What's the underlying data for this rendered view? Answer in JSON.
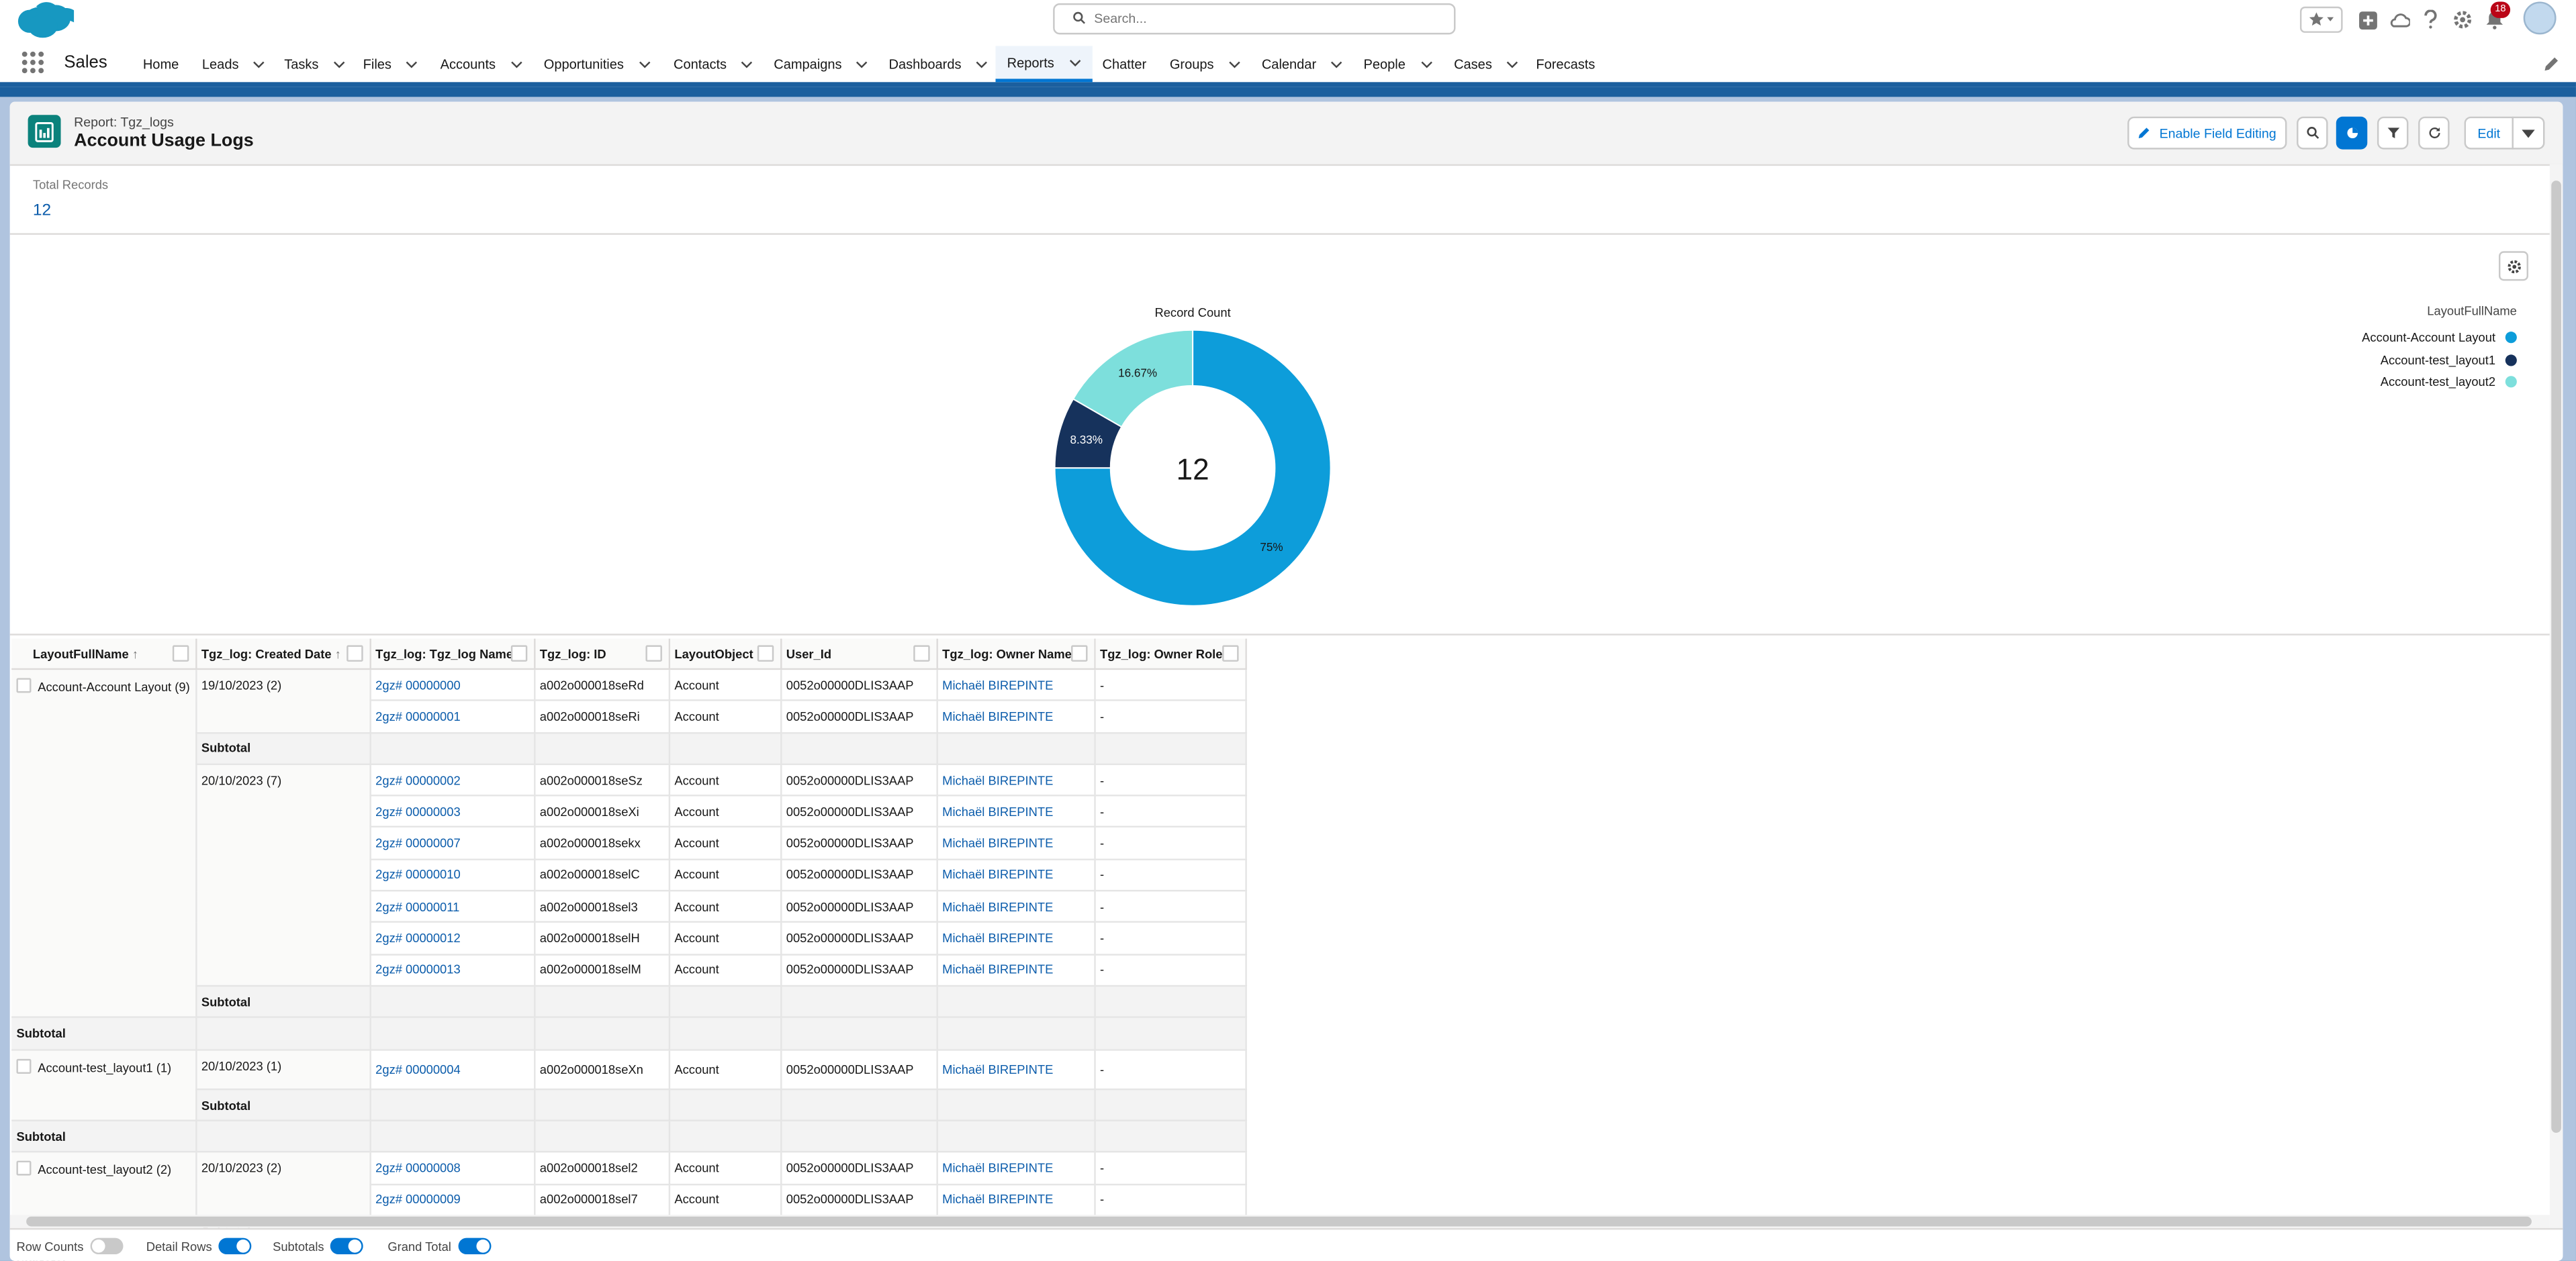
{
  "global": {
    "search_placeholder": "Search...",
    "notification_count": "18"
  },
  "nav": {
    "app_name": "Sales",
    "items": [
      {
        "label": "Home",
        "dropdown": false
      },
      {
        "label": "Leads",
        "dropdown": true
      },
      {
        "label": "Tasks",
        "dropdown": true
      },
      {
        "label": "Files",
        "dropdown": true
      },
      {
        "label": "Accounts",
        "dropdown": true
      },
      {
        "label": "Opportunities",
        "dropdown": true
      },
      {
        "label": "Contacts",
        "dropdown": true
      },
      {
        "label": "Campaigns",
        "dropdown": true
      },
      {
        "label": "Dashboards",
        "dropdown": true
      },
      {
        "label": "Reports",
        "dropdown": true,
        "active": true
      },
      {
        "label": "Chatter",
        "dropdown": false
      },
      {
        "label": "Groups",
        "dropdown": true
      },
      {
        "label": "Calendar",
        "dropdown": true
      },
      {
        "label": "People",
        "dropdown": true
      },
      {
        "label": "Cases",
        "dropdown": true
      },
      {
        "label": "Forecasts",
        "dropdown": false
      }
    ]
  },
  "report": {
    "eyebrow": "Report: Tgz_logs",
    "title": "Account Usage Logs",
    "enable_field_editing": "Enable Field Editing",
    "edit": "Edit",
    "total_records_label": "Total Records",
    "total_records_value": "12"
  },
  "chart": {
    "title": "Record Count",
    "center_value": "12",
    "legend_title": "LayoutFullName",
    "colors": {
      "Account-Account Layout": "#0d9dda",
      "Account-test_layout1": "#16325c",
      "Account-test_layout2": "#7ddfdc"
    }
  },
  "chart_data": {
    "type": "pie",
    "title": "Record Count",
    "categories": [
      "Account-Account Layout",
      "Account-test_layout1",
      "Account-test_layout2"
    ],
    "values": [
      9,
      1,
      2
    ],
    "labels": [
      "75%",
      "8.33%",
      "16.67%"
    ],
    "legend": "top-right"
  },
  "table": {
    "columns": [
      "LayoutFullName",
      "Tgz_log: Created Date",
      "Tgz_log: Tgz_log Name",
      "Tgz_log: ID",
      "LayoutObject",
      "User_Id",
      "Tgz_log: Owner Name",
      "Tgz_log: Owner Role"
    ],
    "subtotal_label": "Subtotal",
    "groups": [
      {
        "name": "Account-Account Layout (9)",
        "dates": [
          {
            "date": "19/10/2023 (2)",
            "rows": [
              [
                "2gz# 00000000",
                "a002o000018seRd",
                "Account",
                "0052o00000DLIS3AAP",
                "Michaël BIREPINTE",
                "-"
              ],
              [
                "2gz# 00000001",
                "a002o000018seRi",
                "Account",
                "0052o00000DLIS3AAP",
                "Michaël BIREPINTE",
                "-"
              ]
            ]
          },
          {
            "date": "20/10/2023 (7)",
            "rows": [
              [
                "2gz# 00000002",
                "a002o000018seSz",
                "Account",
                "0052o00000DLIS3AAP",
                "Michaël BIREPINTE",
                "-"
              ],
              [
                "2gz# 00000003",
                "a002o000018seXi",
                "Account",
                "0052o00000DLIS3AAP",
                "Michaël BIREPINTE",
                "-"
              ],
              [
                "2gz# 00000007",
                "a002o000018sekx",
                "Account",
                "0052o00000DLIS3AAP",
                "Michaël BIREPINTE",
                "-"
              ],
              [
                "2gz# 00000010",
                "a002o000018selC",
                "Account",
                "0052o00000DLIS3AAP",
                "Michaël BIREPINTE",
                "-"
              ],
              [
                "2gz# 00000011",
                "a002o000018sel3",
                "Account",
                "0052o00000DLIS3AAP",
                "Michaël BIREPINTE",
                "-"
              ],
              [
                "2gz# 00000012",
                "a002o000018selH",
                "Account",
                "0052o00000DLIS3AAP",
                "Michaël BIREPINTE",
                "-"
              ],
              [
                "2gz# 00000013",
                "a002o000018selM",
                "Account",
                "0052o00000DLIS3AAP",
                "Michaël BIREPINTE",
                "-"
              ]
            ]
          }
        ]
      },
      {
        "name": "Account-test_layout1 (1)",
        "dates": [
          {
            "date": "20/10/2023 (1)",
            "rows": [
              [
                "2gz# 00000004",
                "a002o000018seXn",
                "Account",
                "0052o00000DLIS3AAP",
                "Michaël BIREPINTE",
                "-"
              ]
            ]
          }
        ]
      },
      {
        "name": "Account-test_layout2 (2)",
        "dates": [
          {
            "date": "20/10/2023 (2)",
            "rows": [
              [
                "2gz# 00000008",
                "a002o000018sel2",
                "Account",
                "0052o00000DLIS3AAP",
                "Michaël BIREPINTE",
                "-"
              ],
              [
                "2gz# 00000009",
                "a002o000018sel7",
                "Account",
                "0052o00000DLIS3AAP",
                "Michaël BIREPINTE",
                "-"
              ]
            ]
          }
        ]
      }
    ]
  },
  "footer": {
    "row_counts": "Row Counts",
    "row_counts_on": false,
    "detail_rows": "Detail Rows",
    "detail_rows_on": true,
    "subtotals": "Subtotals",
    "subtotals_on": true,
    "grand_total": "Grand Total",
    "grand_total_on": true
  }
}
